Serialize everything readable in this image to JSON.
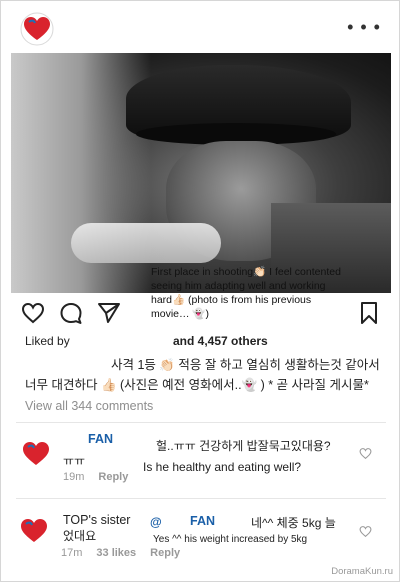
{
  "header": {
    "more_glyph": "• • •"
  },
  "photo": {
    "caption_en": "First place in shooting 👏🏻 I feel contented seeing him adapting well and working hard 👍🏻 (photo is from his previous movie… 👻)"
  },
  "caption_lines": [
    "First place in shooting👏🏻 I feel contented",
    "seeing him adapting well and working",
    "hard👍🏻 (photo is from his previous",
    "movie… 👻)"
  ],
  "likes": {
    "prefix": "Liked by",
    "others": "and 4,457 others"
  },
  "caption_ko": {
    "line1": "사격 1등 👏🏻 적응 잘 하고 열심히 생활하는것 같아서",
    "line2": "너무 대견하다 👍🏻 (사진은 예전 영화에서..👻 ) * 곧 사라질 게시물*"
  },
  "view_all": "View all 344 comments",
  "comments": [
    {
      "author_tag": "FAN",
      "text_ko": "헐..ㅠㅠ 건강하게 밥잘묵고있대용?",
      "text_ko2": "ㅠㅠ",
      "translation": "Is he healthy and eating well?",
      "time": "19m",
      "reply": "Reply"
    },
    {
      "author_tag": "TOP's sister",
      "mention": "@",
      "mention_tag": "FAN",
      "text_ko": "네^^ 체중 5kg 늘",
      "text_ko2": "었대요",
      "translation": "Yes ^^ his weight increased by 5kg",
      "time": "17m",
      "likes": "33 likes",
      "reply": "Reply"
    }
  ],
  "watermark": "DoramaKun.ru",
  "colors": {
    "heart_red": "#d9232d",
    "fan_blue": "#1a5fa8",
    "meta_gray": "#999999"
  }
}
